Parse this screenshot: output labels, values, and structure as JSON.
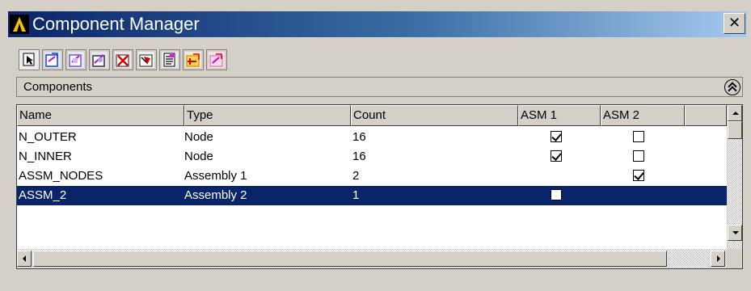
{
  "window": {
    "title": "Component Manager",
    "close_glyph": "✕"
  },
  "toolbar": {
    "buttons": [
      {
        "name": "select-icon"
      },
      {
        "name": "create-component-icon"
      },
      {
        "name": "edit-component-icon"
      },
      {
        "name": "copy-component-icon"
      },
      {
        "name": "delete-component-icon"
      },
      {
        "name": "select-entities-icon"
      },
      {
        "name": "list-icon"
      },
      {
        "name": "create-assembly-icon"
      },
      {
        "name": "edit-assembly-icon"
      }
    ]
  },
  "components_panel": {
    "label": "Components",
    "collapse_icon": "double-chevron-up-icon"
  },
  "table": {
    "columns": [
      {
        "label": "Name"
      },
      {
        "label": "Type"
      },
      {
        "label": "Count"
      },
      {
        "label": "ASM 1"
      },
      {
        "label": "ASM 2"
      },
      {
        "label": ""
      }
    ],
    "rows": [
      {
        "name": "N_OUTER",
        "type": "Node",
        "count": "16",
        "asm1": "checked",
        "asm2": "unchecked",
        "selected": false
      },
      {
        "name": "N_INNER",
        "type": "Node",
        "count": "16",
        "asm1": "checked",
        "asm2": "unchecked",
        "selected": false
      },
      {
        "name": "ASSM_NODES",
        "type": "Assembly 1",
        "count": "2",
        "asm1": "none",
        "asm2": "checked",
        "selected": false
      },
      {
        "name": "ASSM_2",
        "type": "Assembly 2",
        "count": "1",
        "asm1": "unchecked",
        "asm2": "none",
        "selected": true
      }
    ]
  },
  "colors": {
    "selection": "#0a246a",
    "title_gradient_start": "#0a246a",
    "title_gradient_end": "#a6caf0",
    "face": "#d4d0c8"
  }
}
